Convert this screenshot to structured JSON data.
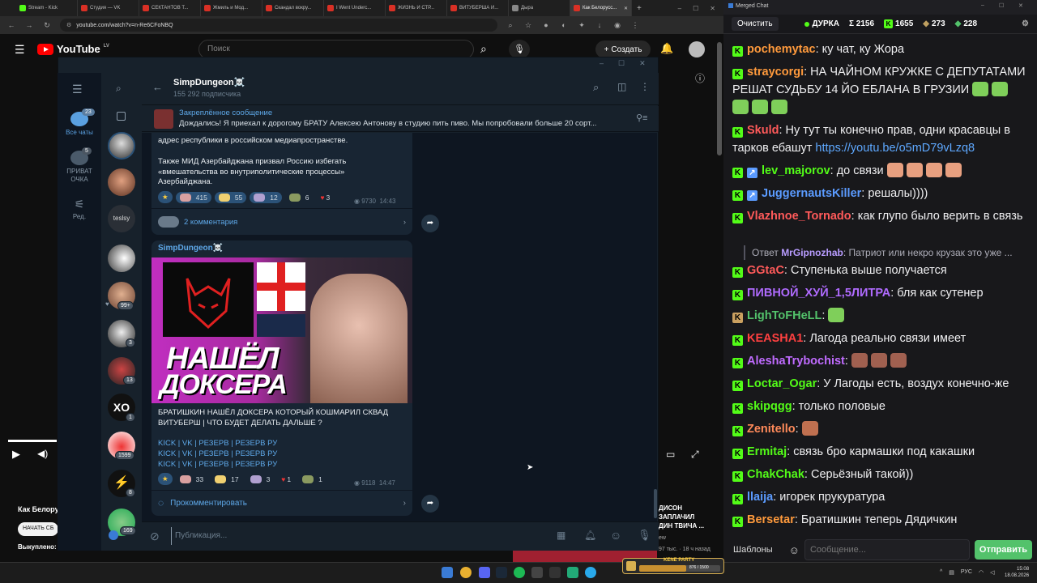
{
  "browser": {
    "tabs": [
      {
        "label": "Stream - Kick",
        "color": "#53fc18"
      },
      {
        "label": "Студия — VK",
        "color": "#d93025"
      },
      {
        "label": "СЕКТАНТОВ Т...",
        "color": "#d93025"
      },
      {
        "label": "Жмиль и Мод...",
        "color": "#d93025"
      },
      {
        "label": "Скандал вокру...",
        "color": "#d93025"
      },
      {
        "label": "I Went Underc...",
        "color": "#d93025"
      },
      {
        "label": "ЖИЗНЬ И СТР...",
        "color": "#d93025"
      },
      {
        "label": "ВИТУБЕРША И...",
        "color": "#d93025"
      },
      {
        "label": "Дыра",
        "color": "#888888"
      },
      {
        "label": "Как Белорусс...",
        "color": "#d93025"
      }
    ],
    "url": "youtube.com/watch?v=n-Re6CFoNBQ"
  },
  "youtube": {
    "logo": "YouTube",
    "region": "LV",
    "search_placeholder": "Поиск",
    "create_label": "Создать",
    "video_title_partial": "Как Белорусс",
    "start_button": "НАЧАТЬ СБ",
    "purchased": "Выкуплено:",
    "side_video": {
      "line1": "ДИСОН",
      "line2": "ЗАПЛАЧИЛ",
      "line3": "ДИН ТВИЧА ...",
      "meta": "97 тыс. · 18 ч назад",
      "channel": "ew"
    }
  },
  "telegram": {
    "folders": [
      {
        "label": "Все чаты",
        "badge": "23"
      },
      {
        "label": "ПРИВАТ ОЧКА",
        "badge": "5"
      },
      {
        "label": "Ред.",
        "badge": ""
      }
    ],
    "avatar_badges": [
      "99+",
      "3",
      "13",
      "1",
      "1599",
      "8",
      "169"
    ],
    "channel_name": "SimpDungeon☠️",
    "subscribers": "155 292 подписчика",
    "pinned_title": "Закреплённое сообщение",
    "pinned_text": "Дождались!  Я приехал к дорогому БРАТУ Алексею Антонову в студию пить пиво. Мы попробовали больше 20 сорт...",
    "msg1": {
      "text_a": "адрес республики в российском медиапространстве.",
      "text_b": "Также МИД Азербайджана призвал Россию избегать «вмешательства во внутриполитические процессы» Азербайджана.",
      "reactions": [
        "415",
        "55",
        "12",
        "6",
        "3"
      ],
      "views": "9730",
      "time": "14:43",
      "comments": "2 комментария"
    },
    "msg2": {
      "author": "SimpDungeon☠️",
      "thumb_title_1": "НАШЁЛ",
      "thumb_title_2": "ДОКСЕРА",
      "text": "БРАТИШКИН НАШЁЛ ДОКСЕРА КОТОРЫЙ КОШМАРИЛ СКВАД ВИТУБЕРШ | ЧТО БУДЕТ ДЕЛАТЬ ДАЛЬШЕ ?",
      "links": "KICK | VK | РЕЗЕРВ | РЕЗЕРВ РУ",
      "reactions": [
        "33",
        "17",
        "3",
        "1",
        "1"
      ],
      "views": "9118",
      "time": "14:47",
      "comment_action": "Прокомментировать"
    },
    "compose_placeholder": "Публикация..."
  },
  "chat": {
    "window_title": "Merged Chat",
    "clear_button": "Очистить",
    "streamer": "ДУРКА",
    "stats": [
      "Σ 2156",
      "1655",
      "273",
      "228"
    ],
    "messages": [
      {
        "name": "pochemytac",
        "color": "#ff9a3c",
        "text": ": ку чат, ку Жора"
      },
      {
        "name": "straycorgi",
        "color": "#ff9a3c",
        "text": ": НА ЧАЙНОМ КРУЖКЕ С ДЕПУТАТАМИ РЕШАТ СУДЬБУ 14 ЙО ЕБЛАНА В ГРУЗИИ"
      },
      {
        "name": "Skuld",
        "color": "#ff5a5a",
        "text": ": Ну тут ты конечно прав, одни красавцы в тарков ебашут ",
        "link": "https://youtu.be/o5mD79vLzq8"
      },
      {
        "name": "lev_majorov",
        "color": "#53fc18",
        "text": ": до связи"
      },
      {
        "name": "JuggernautsKiller",
        "color": "#5b9bff",
        "text": ": решалы))))"
      },
      {
        "name": "Vlazhnoe_Tornado",
        "color": "#ff5a5a",
        "text": ": как глупо было верить в связь"
      },
      {
        "name": "MrGipnozhab",
        "color": "#b89cff",
        "text": ": Патриот или некро крузак это уже ...",
        "reply_prefix": "Ответ "
      },
      {
        "name": "GGtaC",
        "color": "#ff5a5a",
        "text": ": Ступенька выше получается"
      },
      {
        "name": "ПИВНОЙ_ХУЙ_1,5ЛИТРА",
        "color": "#b06bff",
        "text": ": бля как сутенер"
      },
      {
        "name": "LighToFHeLL",
        "color": "#53c26b",
        "text": ":"
      },
      {
        "name": "KEASHA1",
        "color": "#ff4040",
        "text": ": Лагода реально связи имеет"
      },
      {
        "name": "AleshaTrybochist",
        "color": "#c06bff",
        "text": ":"
      },
      {
        "name": "Loctar_Ogar",
        "color": "#53fc18",
        "text": ": У Лагоды есть, воздух конечно-же"
      },
      {
        "name": "skipqgg",
        "color": "#53fc18",
        "text": ": только половые"
      },
      {
        "name": "Zenitello",
        "color": "#ff8a5a",
        "text": ":"
      },
      {
        "name": "Ermitaj",
        "color": "#53fc18",
        "text": ": связь бро кармашки под какашки"
      },
      {
        "name": "ChakChak",
        "color": "#53fc18",
        "text": ": Серьёзный такой))"
      },
      {
        "name": "llaija",
        "color": "#5b9bff",
        "text": ": игорек прукуратура"
      },
      {
        "name": "Bersetar",
        "color": "#ff9a3c",
        "text": ": Братишкин теперь Дядичкин"
      }
    ],
    "templates_button": "Шаблоны",
    "input_placeholder": "Сообщение...",
    "send_button": "Отправить"
  },
  "taskbar": {
    "lang": "РУС",
    "time": "15:08",
    "date": "18.08.2026",
    "widget_title": "KENE PARTY",
    "widget_count": "876 / 1500"
  }
}
